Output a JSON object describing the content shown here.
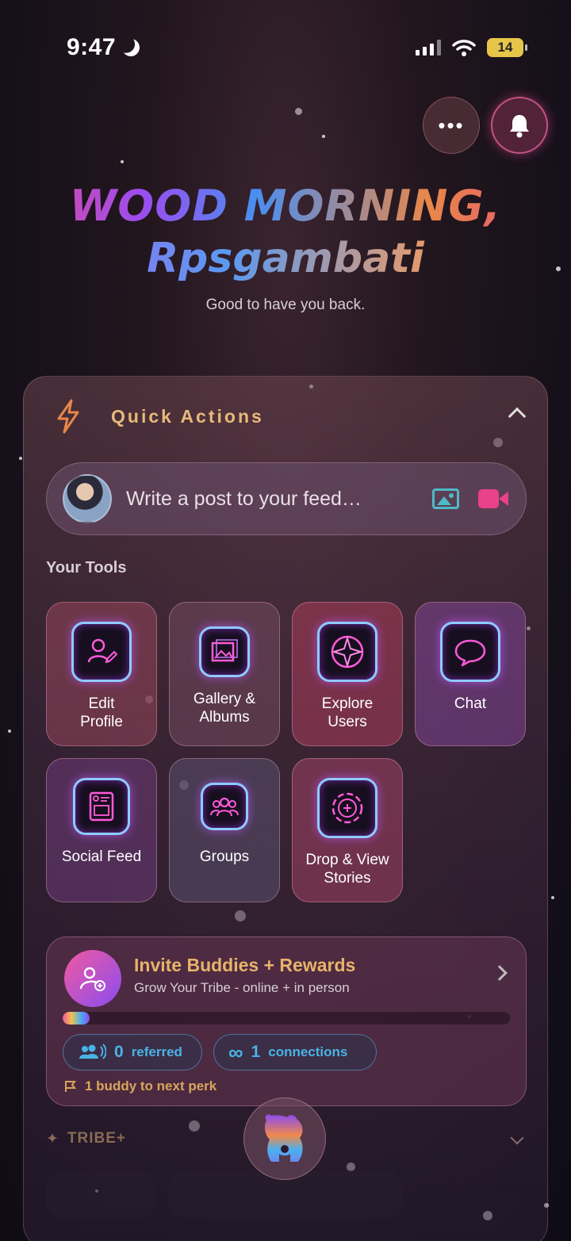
{
  "status_bar": {
    "time": "9:47",
    "battery": "14"
  },
  "header": {
    "greeting_line1": "WOOD MORNING,",
    "greeting_line2": "Rpsgambati",
    "subtitle": "Good to have you back."
  },
  "quick_actions": {
    "title": "Quick Actions",
    "composer_placeholder": "Write a post to your feed…",
    "tools_label": "Your Tools",
    "tools": [
      {
        "label": "Edit Profile",
        "icon": "edit-profile-icon"
      },
      {
        "label": "Gallery & Albums",
        "icon": "gallery-icon"
      },
      {
        "label": "Explore Users",
        "icon": "compass-icon"
      },
      {
        "label": "Chat",
        "icon": "chat-bubble-icon"
      },
      {
        "label": "Social Feed",
        "icon": "feed-icon"
      },
      {
        "label": "Groups",
        "icon": "groups-icon"
      },
      {
        "label": "Drop & View Stories",
        "icon": "stories-icon"
      }
    ]
  },
  "invite": {
    "title": "Invite Buddies + Rewards",
    "subtitle": "Grow Your Tribe - online + in person",
    "progress": 0.06,
    "referred_count": "0",
    "referred_label": "referred",
    "connections_count": "1",
    "connections_label": "connections",
    "perk_text": "1 buddy to next perk"
  },
  "tribe": {
    "label": "TRIBE+"
  },
  "colors": {
    "accent_gold": "#e8b97a",
    "accent_pink": "#e9418a",
    "accent_cyan": "#4fb9c8",
    "pill_blue": "#4ab3e6"
  }
}
